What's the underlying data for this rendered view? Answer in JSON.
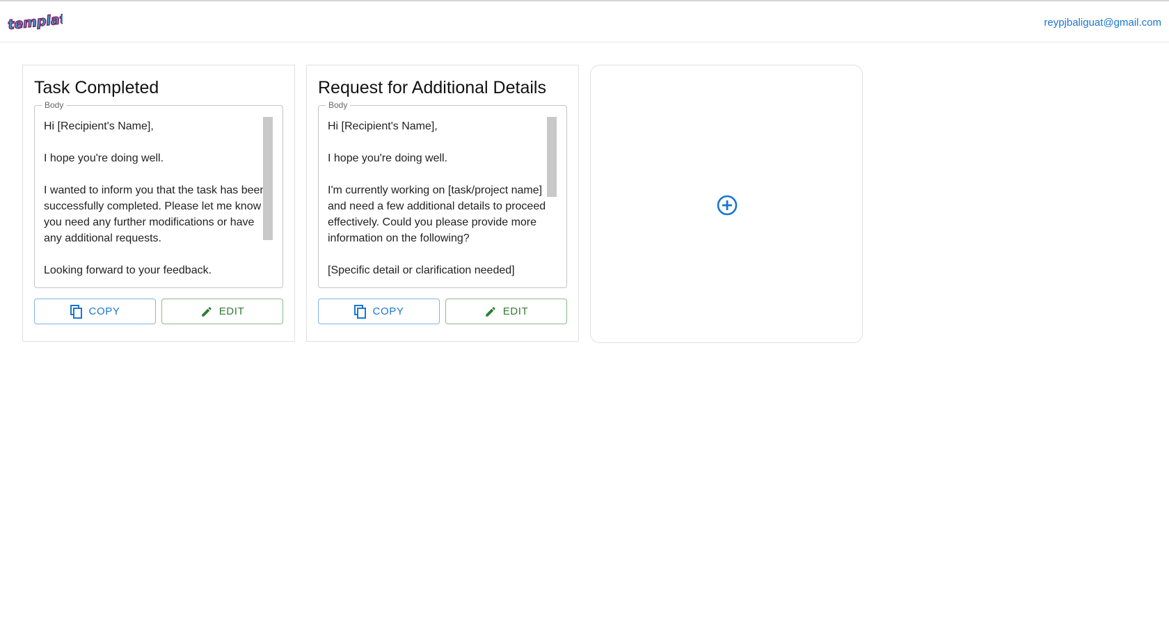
{
  "header": {
    "logo_text": "template",
    "user_email": "reypjbaliguat@gmail.com"
  },
  "templates": [
    {
      "title": "Task Completed",
      "body_label": "Body",
      "body": "Hi [Recipient's Name],\n\nI hope you're doing well.\n\nI wanted to inform you that the task has been successfully completed. Please let me know if you need any further modifications or have any additional requests.\n\nLooking forward to your feedback.",
      "copy_label": "COPY",
      "edit_label": "EDIT"
    },
    {
      "title": "Request for Additional Details",
      "body_label": "Body",
      "body": "Hi [Recipient's Name],\n\nI hope you're doing well.\n\nI'm currently working on [task/project name] and need a few additional details to proceed effectively. Could you please provide more information on the following?\n\n[Specific detail or clarification needed]",
      "copy_label": "COPY",
      "edit_label": "EDIT"
    }
  ],
  "add_card": {
    "icon": "add-circle-icon"
  },
  "colors": {
    "primary": "#1976d2",
    "success": "#2e7d32",
    "border": "#e0e0e0"
  }
}
